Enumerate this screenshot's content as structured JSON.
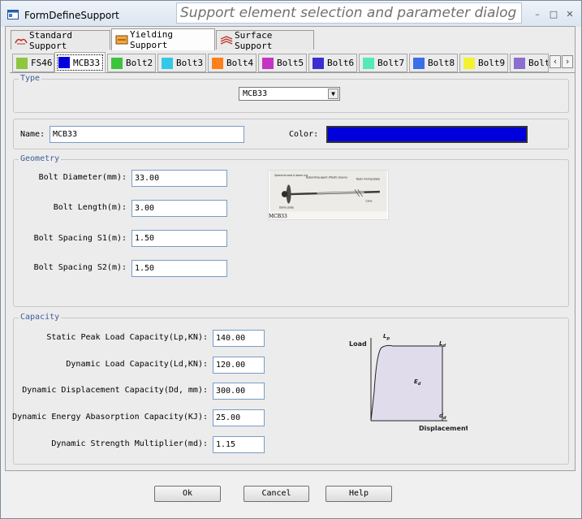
{
  "window": {
    "title": "FormDefineSupport",
    "banner": "Support element selection and parameter dialog"
  },
  "support_tabs": [
    {
      "label": "Standard Support",
      "icon": "standard-support-icon"
    },
    {
      "label": "Yielding Support",
      "icon": "yielding-support-icon"
    },
    {
      "label": "Surface Support",
      "icon": "surface-support-icon"
    }
  ],
  "bolt_tabs": [
    {
      "label": "FS46",
      "color": "#8dc63f"
    },
    {
      "label": "MCB33",
      "color": "#0000dd"
    },
    {
      "label": "Bolt2",
      "color": "#3dc43d"
    },
    {
      "label": "Bolt3",
      "color": "#33c8e8"
    },
    {
      "label": "Bolt4",
      "color": "#ff7f1a"
    },
    {
      "label": "Bolt5",
      "color": "#c435c4"
    },
    {
      "label": "Bolt6",
      "color": "#3a2ed0"
    },
    {
      "label": "Bolt7",
      "color": "#55e8bb"
    },
    {
      "label": "Bolt8",
      "color": "#3a6fe8"
    },
    {
      "label": "Bolt9",
      "color": "#f2f230"
    },
    {
      "label": "Bolt",
      "color": "#8a6fd0"
    }
  ],
  "type_group": {
    "title": "Type",
    "selected": "MCB33"
  },
  "name_row": {
    "name_label": "Name:",
    "name_value": "MCB33",
    "color_label": "Color:",
    "color_value": "#0000dd"
  },
  "geometry": {
    "title": "Geometry",
    "fields": [
      {
        "label": "Bolt Diameter(mm):",
        "value": "33.00"
      },
      {
        "label": "Bolt Length(m):",
        "value": "3.00"
      },
      {
        "label": "Bolt Spacing S1(m):",
        "value": "1.50"
      },
      {
        "label": "Bolt Spacing S2(m):",
        "value": "1.50"
      }
    ],
    "image_caption": "MCB33",
    "image_labels": {
      "spherical": "Spherical seat & dome nut",
      "debonding": "Debonding agent (Plastic sleeve)",
      "resin": "Resin mixing blade",
      "dome": "Dome plate",
      "cone": "Cone"
    }
  },
  "capacity": {
    "title": "Capacity",
    "fields": [
      {
        "label": "Static Peak Load Capacity(Lp,KN):",
        "value": "140.00"
      },
      {
        "label": "Dynamic Load Capacity(Ld,KN):",
        "value": "120.00"
      },
      {
        "label": "Dynamic Displacement Capacity(Dd, mm):",
        "value": "300.00"
      },
      {
        "label": "Dynamic Energy Abasorption Capacity(KJ):",
        "value": "25.00"
      },
      {
        "label": "Dynamic Strength Multiplier(md):",
        "value": "1.15"
      }
    ],
    "graph": {
      "y_label": "Load",
      "x_label": "Displacement",
      "lp": "L",
      "lp_sub": "p",
      "ld": "L",
      "ld_sub": "d",
      "ed": "E",
      "ed_sub": "d",
      "dd": "d",
      "dd_sub": "d"
    }
  },
  "buttons": {
    "ok": "Ok",
    "cancel": "Cancel",
    "help": "Help"
  }
}
